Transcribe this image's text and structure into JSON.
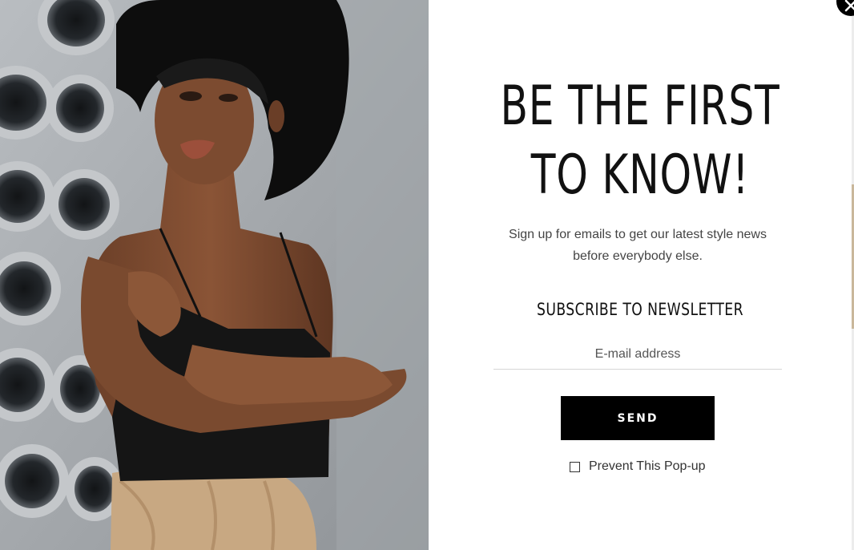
{
  "popup": {
    "headline_line1": "BE THE FIRST",
    "headline_line2": "TO KNOW!",
    "subtitle": "Sign up for emails to get our latest style news before everybody else.",
    "form_title": "SUBSCRIBE TO NEWSLETTER",
    "email_placeholder": "E-mail address",
    "send_label": "SEND",
    "prevent_label": "Prevent This Pop-up",
    "prevent_checked": false
  },
  "icons": {
    "close": "close-icon",
    "checkbox": "checkbox-icon"
  },
  "colors": {
    "button_bg": "#000000",
    "button_text": "#ffffff",
    "headline": "#111111",
    "body_text": "#444444",
    "background": "#ffffff"
  }
}
